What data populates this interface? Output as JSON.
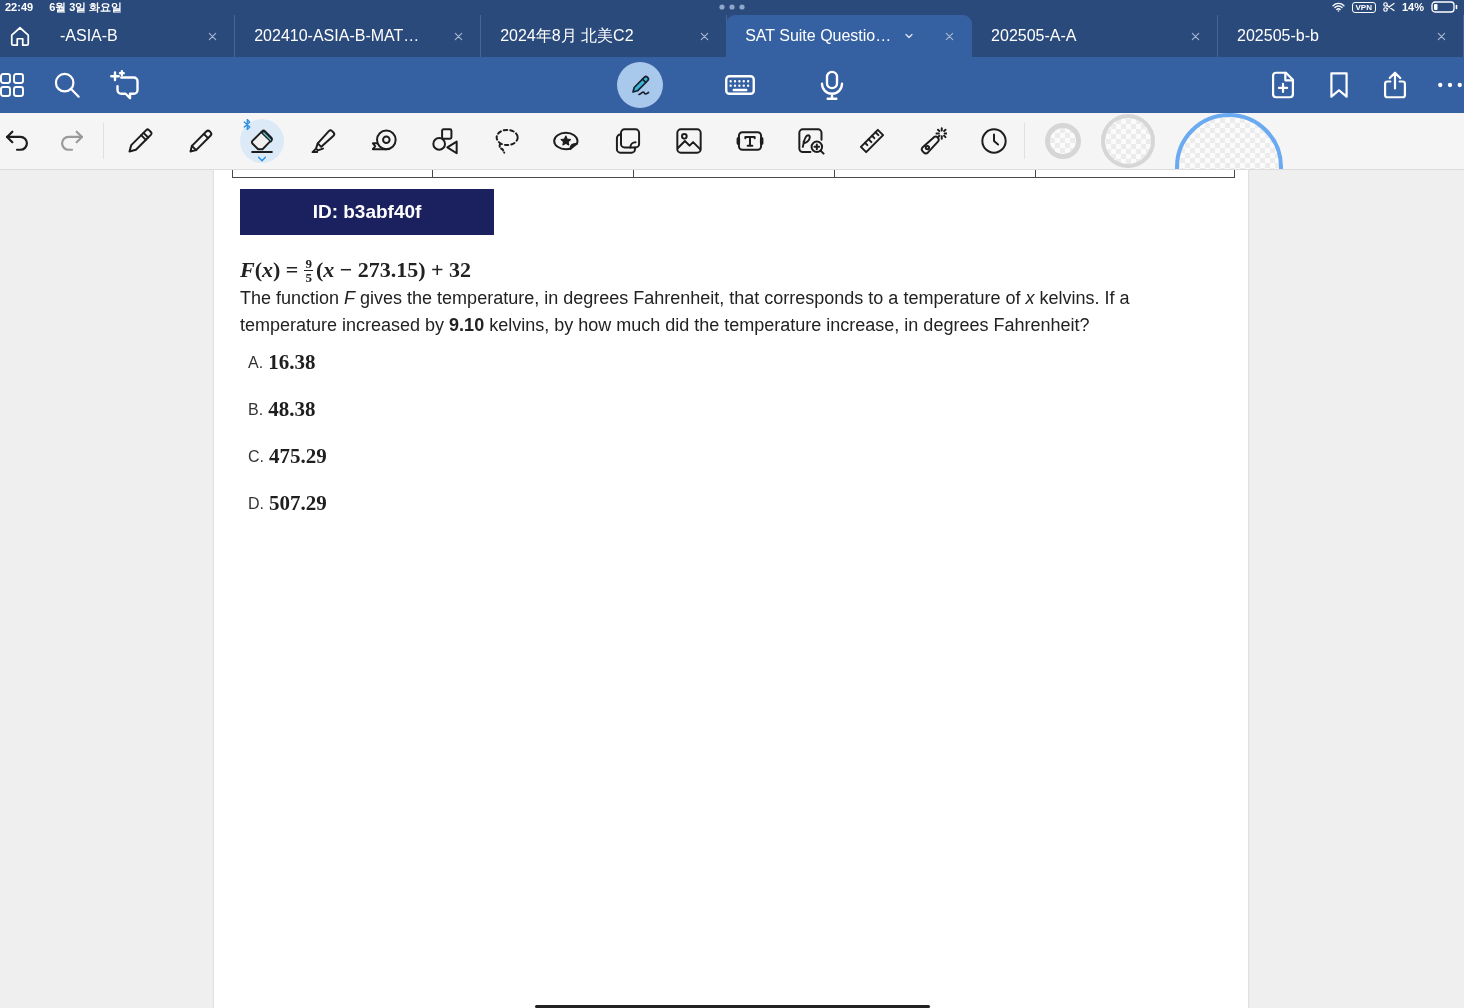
{
  "status_bar": {
    "time": "22:49",
    "date": "6월 3일 화요일",
    "vpn": "VPN",
    "battery": "14%"
  },
  "tabs": [
    {
      "label": "-ASIA-B",
      "selected": false
    },
    {
      "label": "202410-ASIA-B-MAT…",
      "selected": false
    },
    {
      "label": "2024年8月 北美C2",
      "selected": false
    },
    {
      "label": "SAT Suite Questio…",
      "selected": true
    },
    {
      "label": "202505-A-A",
      "selected": false
    },
    {
      "label": "202505-b-b",
      "selected": false
    }
  ],
  "input_modes": [
    {
      "selected": true
    },
    {
      "selected": false
    },
    {
      "selected": false
    }
  ],
  "history": [
    {
      "disabled": false
    },
    {
      "disabled": true
    }
  ],
  "tools": [
    {
      "selected": false
    },
    {
      "selected": false
    },
    {
      "selected": true
    },
    {
      "selected": false
    },
    {
      "selected": false
    },
    {
      "selected": false
    },
    {
      "selected": false
    },
    {
      "selected": false
    },
    {
      "selected": false
    },
    {
      "selected": false
    },
    {
      "selected": false
    },
    {
      "selected": false
    },
    {
      "selected": false
    },
    {
      "selected": false
    },
    {
      "selected": false
    }
  ],
  "stroke_sizes": [
    {
      "selected": false
    },
    {
      "selected": false
    },
    {
      "selected": true
    }
  ],
  "question": {
    "id": "ID: b3abf40f",
    "formula": {
      "before": "*F*(*x*) =",
      "numerator": "9",
      "denominator": "5",
      "after": "(*x* − 273.15) + 32"
    },
    "text": "The function *F* gives the temperature, in degrees Fahrenheit, that corresponds to a temperature of *x* kelvins. If a temperature increased by **9.10** kelvins, by how much did the temperature increase, in degrees Fahrenheit?",
    "choices": [
      {
        "letter": "A.",
        "value": "16.38"
      },
      {
        "letter": "B.",
        "value": "48.38"
      },
      {
        "letter": "C.",
        "value": "475.29"
      },
      {
        "letter": "D.",
        "value": "507.29"
      }
    ]
  }
}
